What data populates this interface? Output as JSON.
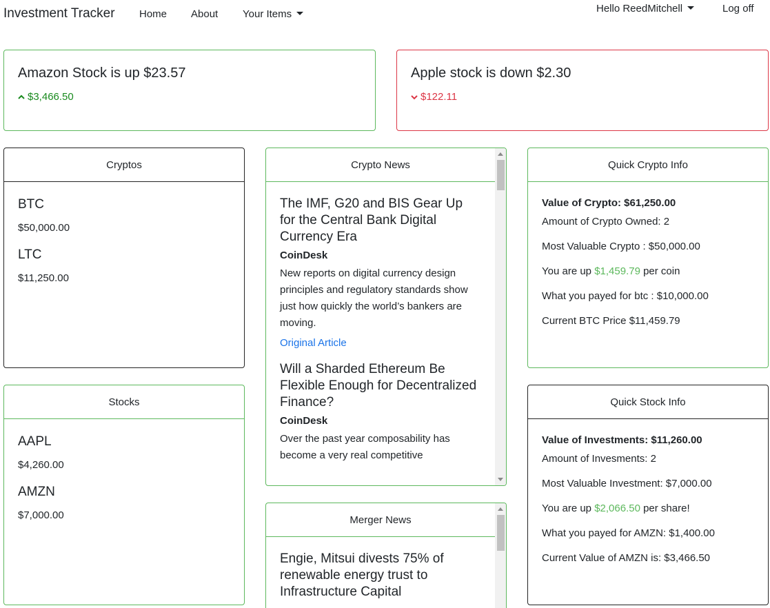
{
  "nav": {
    "brand": "Investment Tracker",
    "home": "Home",
    "about": "About",
    "items": "Your Items",
    "user": "Hello ReedMitchell",
    "logoff": "Log off"
  },
  "alerts": [
    {
      "title": "Amazon Stock is up $23.57",
      "price": "$3,466.50",
      "direction": "up",
      "color": "#198a1e"
    },
    {
      "title": "Apple stock is down $2.30",
      "price": "$122.11",
      "direction": "down",
      "color": "#dc3545"
    }
  ],
  "cryptos": {
    "header": "Cryptos",
    "items": [
      {
        "symbol": "BTC",
        "value": "$50,000.00"
      },
      {
        "symbol": "LTC",
        "value": "$11,250.00"
      }
    ]
  },
  "stocks": {
    "header": "Stocks",
    "items": [
      {
        "symbol": "AAPL",
        "value": "$4,260.00"
      },
      {
        "symbol": "AMZN",
        "value": "$7,000.00"
      }
    ]
  },
  "crypto_news": {
    "header": "Crypto News",
    "articles": [
      {
        "title": "The IMF, G20 and BIS Gear Up for the Central Bank Digital Currency Era",
        "source": "CoinDesk",
        "description": "New reports on digital currency design principles and regulatory standards show just how quickly the world’s bankers are moving.",
        "link": "Original Article"
      },
      {
        "title": "Will a Sharded Ethereum Be Flexible Enough for Decentralized Finance?",
        "source": "CoinDesk",
        "description": "Over the past year composability has become a very real competitive"
      }
    ]
  },
  "merger_news": {
    "header": "Merger News",
    "articles": [
      {
        "title": "Engie, Mitsui divests 75% of renewable energy trust to Infrastructure Capital"
      }
    ]
  },
  "quick_crypto": {
    "header": "Quick Crypto Info",
    "value_label": "Value of Crypto: $61,250.00",
    "amount": "Amount of Crypto Owned: 2",
    "most_valuable": "Most Valuable Crypto : $50,000.00",
    "up_prefix": "You are up ",
    "up_value": "$1,459.79",
    "up_suffix": " per coin",
    "payed": "What you payed for btc : $10,000.00",
    "current": "Current BTC Price $11,459.79"
  },
  "quick_stock": {
    "header": "Quick Stock Info",
    "value_label": "Value of Investments: $11,260.00",
    "amount": "Amount of Invesments: 2",
    "most_valuable": "Most Valuable Investment: $7,000.00",
    "up_prefix": "You are up ",
    "up_value": "$2,066.50",
    "up_suffix": " per share!",
    "payed": "What you payed for AMZN: $1,400.00",
    "current": "Current Value of AMZN is: $3,466.50"
  },
  "colors": {
    "accent_green": "#5cb85c",
    "alert_red": "#dc3545",
    "link_blue": "#1a73e8"
  }
}
